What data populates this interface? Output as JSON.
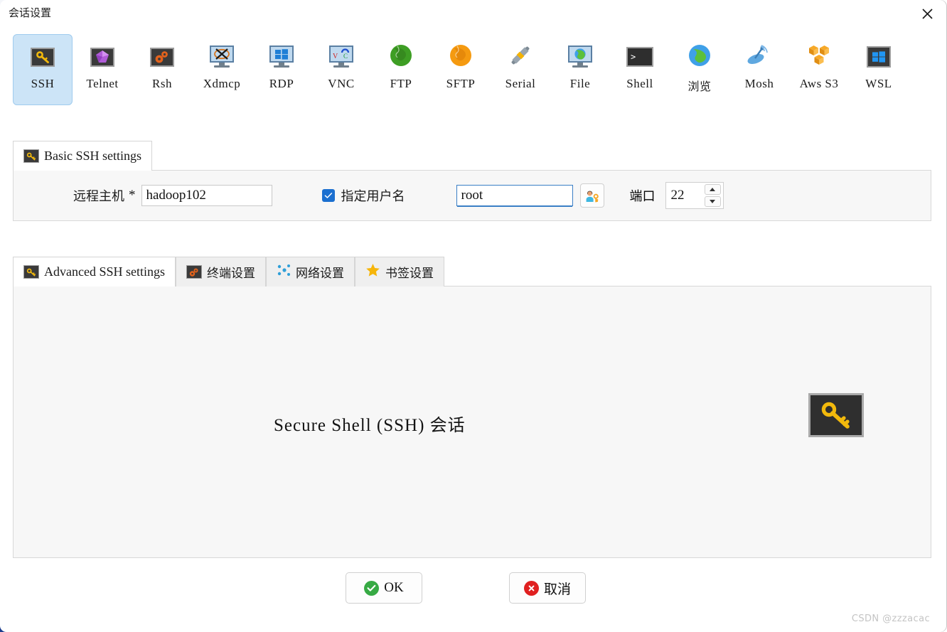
{
  "dialog": {
    "title": "会话设置",
    "close_label": "×"
  },
  "protocols": [
    {
      "label": "SSH",
      "icon": "key-icon",
      "selected": true
    },
    {
      "label": "Telnet",
      "icon": "gem-icon",
      "selected": false
    },
    {
      "label": "Rsh",
      "icon": "gears-icon",
      "selected": false
    },
    {
      "label": "Xdmcp",
      "icon": "x-monitor-icon",
      "selected": false
    },
    {
      "label": "RDP",
      "icon": "windows-monitor-icon",
      "selected": false
    },
    {
      "label": "VNC",
      "icon": "vnc-monitor-icon",
      "selected": false
    },
    {
      "label": "FTP",
      "icon": "green-globe-icon",
      "selected": false
    },
    {
      "label": "SFTP",
      "icon": "orange-globe-icon",
      "selected": false
    },
    {
      "label": "Serial",
      "icon": "plug-icon",
      "selected": false
    },
    {
      "label": "File",
      "icon": "globe-monitor-icon",
      "selected": false
    },
    {
      "label": "Shell",
      "icon": "terminal-icon",
      "selected": false
    },
    {
      "label": "浏览",
      "icon": "blue-globe-icon",
      "selected": false,
      "cjk": true
    },
    {
      "label": "Mosh",
      "icon": "satellite-icon",
      "selected": false
    },
    {
      "label": "Aws S3",
      "icon": "aws-cubes-icon",
      "selected": false
    },
    {
      "label": "WSL",
      "icon": "windows-icon",
      "selected": false
    }
  ],
  "basic": {
    "tab_label": "Basic SSH settings",
    "tab_icon": "key-icon",
    "host_label": "远程主机",
    "host_required_mark": "*",
    "host_value": "hadoop102",
    "specify_user_label": "指定用户名",
    "specify_user_checked": true,
    "user_value": "root",
    "user_button_icon": "user-key-icon",
    "port_label": "端口",
    "port_value": "22"
  },
  "advanced_tabs": [
    {
      "label": "Advanced SSH settings",
      "icon": "key-icon",
      "active": true,
      "cjk": false
    },
    {
      "label": "终端设置",
      "icon": "gears-icon",
      "active": false,
      "cjk": true
    },
    {
      "label": "网络设置",
      "icon": "network-icon",
      "active": false,
      "cjk": true
    },
    {
      "label": "书签设置",
      "icon": "star-icon",
      "active": false,
      "cjk": true
    }
  ],
  "content": {
    "caption_latin": "Secure Shell (SSH)",
    "caption_cjk": "会话",
    "big_icon": "key-icon"
  },
  "footer": {
    "ok_label": "OK",
    "cancel_label": "取消"
  },
  "watermark": "CSDN @zzzacac",
  "colors": {
    "selected_tile": "#cce4f7",
    "accent_blue": "#1b6fd0",
    "ok_green": "#37aa44",
    "cancel_red": "#e02020",
    "key_yellow": "#f2b90c"
  }
}
